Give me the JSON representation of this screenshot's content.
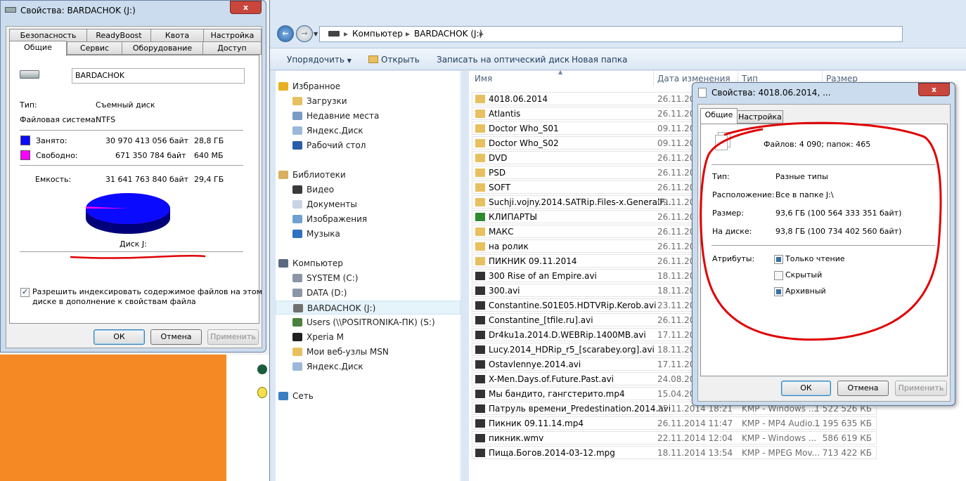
{
  "drive_dialog": {
    "title": "Свойства: BARDACHOK (J:)",
    "close": "x",
    "tabs_back": [
      "Безопасность",
      "ReadyBoost",
      "Квота",
      "Настройка"
    ],
    "tabs_front": [
      "Общие",
      "Сервис",
      "Оборудование",
      "Доступ"
    ],
    "name_value": "BARDACHOK",
    "type_label": "Тип:",
    "type_value": "Съемный диск",
    "fs_label": "Файловая система:",
    "fs_value": "NTFS",
    "used_label": "Занято:",
    "used_bytes": "30 970 413 056 байт",
    "used_size": "28,8 ГБ",
    "free_label": "Свободно:",
    "free_bytes": "671 350 784 байт",
    "free_size": "640 МБ",
    "capacity_label": "Емкость:",
    "capacity_bytes": "31 641 763 840 байт",
    "capacity_size": "29,4 ГБ",
    "used_fraction": 0.979,
    "disk_label": "Диск J:",
    "index_text_1": "Разрешить индексировать содержимое файлов на этом",
    "index_text_2": "диске в дополнение к свойствам файла",
    "ok": "ОК",
    "cancel": "Отмена",
    "apply": "Применить"
  },
  "explorer": {
    "breadcrumb": [
      "Компьютер",
      "BARDACHOK (J:)"
    ],
    "toolbar": [
      "Упорядочить",
      "Открыть",
      "Записать на оптический диск",
      "Новая папка"
    ],
    "columns": [
      "Имя",
      "Дата изменения",
      "Тип",
      "Размер"
    ],
    "nav": [
      {
        "label": "Избранное",
        "icon": "star-icon",
        "group": true
      },
      {
        "label": "Загрузки",
        "icon": "folder-icon"
      },
      {
        "label": "Недавние места",
        "icon": "recent-places-icon"
      },
      {
        "label": "Яндекс.Диск",
        "icon": "cloud-icon"
      },
      {
        "label": "Рабочий стол",
        "icon": "desktop-icon"
      },
      {
        "label": "Библиотеки",
        "icon": "library-icon",
        "group": true
      },
      {
        "label": "Видео",
        "icon": "video-icon"
      },
      {
        "label": "Документы",
        "icon": "documents-icon"
      },
      {
        "label": "Изображения",
        "icon": "pictures-icon"
      },
      {
        "label": "Музыка",
        "icon": "music-icon"
      },
      {
        "label": "Компьютер",
        "icon": "computer-icon",
        "group": true
      },
      {
        "label": "SYSTEM (C:)",
        "icon": "drive-icon"
      },
      {
        "label": "DATA (D:)",
        "icon": "drive-icon"
      },
      {
        "label": "BARDACHOK (J:)",
        "icon": "usb-drive-icon",
        "selected": true
      },
      {
        "label": "Users (\\\\POSITRONIKA-ПК) (S:)",
        "icon": "network-drive-icon"
      },
      {
        "label": "Xperia M",
        "icon": "phone-icon"
      },
      {
        "label": "Мои веб-узлы MSN",
        "icon": "folder-icon"
      },
      {
        "label": "Яндекс.Диск",
        "icon": "cloud-icon"
      },
      {
        "label": "Сеть",
        "icon": "network-icon",
        "group": true
      }
    ],
    "files": [
      {
        "name": "4018.06.2014",
        "date": "26.11.201",
        "type": "",
        "size": "",
        "kind": "folder"
      },
      {
        "name": "Atlantis",
        "date": "26.11.201",
        "type": "",
        "size": "",
        "kind": "folder"
      },
      {
        "name": "Doctor Who_S01",
        "date": "09.11.201",
        "type": "",
        "size": "",
        "kind": "folder"
      },
      {
        "name": "Doctor Who_S02",
        "date": "09.11.201",
        "type": "",
        "size": "",
        "kind": "folder"
      },
      {
        "name": "DVD",
        "date": "26.11.201",
        "type": "",
        "size": "",
        "kind": "folder"
      },
      {
        "name": "PSD",
        "date": "26.11.201",
        "type": "",
        "size": "",
        "kind": "folder"
      },
      {
        "name": "SOFT",
        "date": "26.11.201",
        "type": "",
        "size": "",
        "kind": "folder"
      },
      {
        "name": "Suchji.vojny.2014.SATRip.Files-x.GeneralF...",
        "date": "09.11.201",
        "type": "",
        "size": "",
        "kind": "folder"
      },
      {
        "name": "КЛИПАРТЫ",
        "date": "26.11.201",
        "type": "",
        "size": "",
        "kind": "tree"
      },
      {
        "name": "МАКС",
        "date": "26.11.201",
        "type": "",
        "size": "",
        "kind": "folder"
      },
      {
        "name": "на ролик",
        "date": "26.11.201",
        "type": "",
        "size": "",
        "kind": "folder"
      },
      {
        "name": "ПИКНИК 09.11.2014",
        "date": "26.11.201",
        "type": "",
        "size": "",
        "kind": "folder"
      },
      {
        "name": "300 Rise of an Empire.avi",
        "date": "18.11.201",
        "type": "",
        "size": "",
        "kind": "avi"
      },
      {
        "name": "300.avi",
        "date": "18.11.201",
        "type": "",
        "size": "",
        "kind": "avi"
      },
      {
        "name": "Constantine.S01E05.HDTVRip.Kerob.avi",
        "date": "23.11.201",
        "type": "",
        "size": "",
        "kind": "avi"
      },
      {
        "name": "Constantine_[tfile.ru].avi",
        "date": "26.11.201",
        "type": "",
        "size": "",
        "kind": "avi"
      },
      {
        "name": "Dr4ku1a.2014.D.WEBRip.1400MB.avi",
        "date": "17.11.201",
        "type": "",
        "size": "",
        "kind": "avi"
      },
      {
        "name": "Lucy.2014_HDRip_r5_[scarabey.org].avi",
        "date": "18.11.201",
        "type": "",
        "size": "",
        "kind": "avi"
      },
      {
        "name": "Ostavlennye.2014.avi",
        "date": "17.11.201",
        "type": "",
        "size": "",
        "kind": "avi"
      },
      {
        "name": "X-Men.Days.of.Future.Past.avi",
        "date": "24.08.201",
        "type": "",
        "size": "",
        "kind": "avi"
      },
      {
        "name": "Мы бандито, гангстерито.mp4",
        "date": "15.04.201",
        "type": "",
        "size": "",
        "kind": "mp4"
      },
      {
        "name": "Патруль времени_Predestination.2014.avi",
        "date": "25.11.2014 18:21",
        "type": "KMP - Windows ...",
        "size": "1 522 526 КБ",
        "kind": "avi"
      },
      {
        "name": "Пикник 09.11.14.mp4",
        "date": "26.11.2014 11:47",
        "type": "KMP - MP4 Audio...",
        "size": "1 195 635 КБ",
        "kind": "mp4"
      },
      {
        "name": "пикник.wmv",
        "date": "22.11.2014 12:04",
        "type": "KMP - Windows ...",
        "size": "586 619 КБ",
        "kind": "wmv"
      },
      {
        "name": "Пища.Богов.2014-03-12.mpg",
        "date": "18.11.2014 13:54",
        "type": "KMP - MPEG Mov...",
        "size": "713 422 КБ",
        "kind": "mpg"
      }
    ]
  },
  "folder_dialog": {
    "title": "Свойства: 4018.06.2014, ...",
    "close": "x",
    "tabs": [
      "Общие",
      "Настройка"
    ],
    "summary": "Файлов: 4 090; папок: 465",
    "type_label": "Тип:",
    "type_value": "Разные типы",
    "location_label": "Расположение:",
    "location_value": "Все в папке J:\\",
    "size_label": "Размер:",
    "size_value": "93,6 ГБ (100 564 333 351 байт)",
    "disk_label": "На диске:",
    "disk_value": "93,8 ГБ (100 734 402 560 байт)",
    "attributes_label": "Атрибуты:",
    "attr_readonly": "Только чтение",
    "attr_hidden": "Скрытый",
    "attr_archive": "Архивный",
    "ok": "ОК",
    "cancel": "Отмена",
    "apply": "Применить"
  },
  "colors": {
    "used": "#0a0aff",
    "free": "#ff00ff",
    "annotation": "#e00000",
    "desktop": "#f58a24"
  }
}
